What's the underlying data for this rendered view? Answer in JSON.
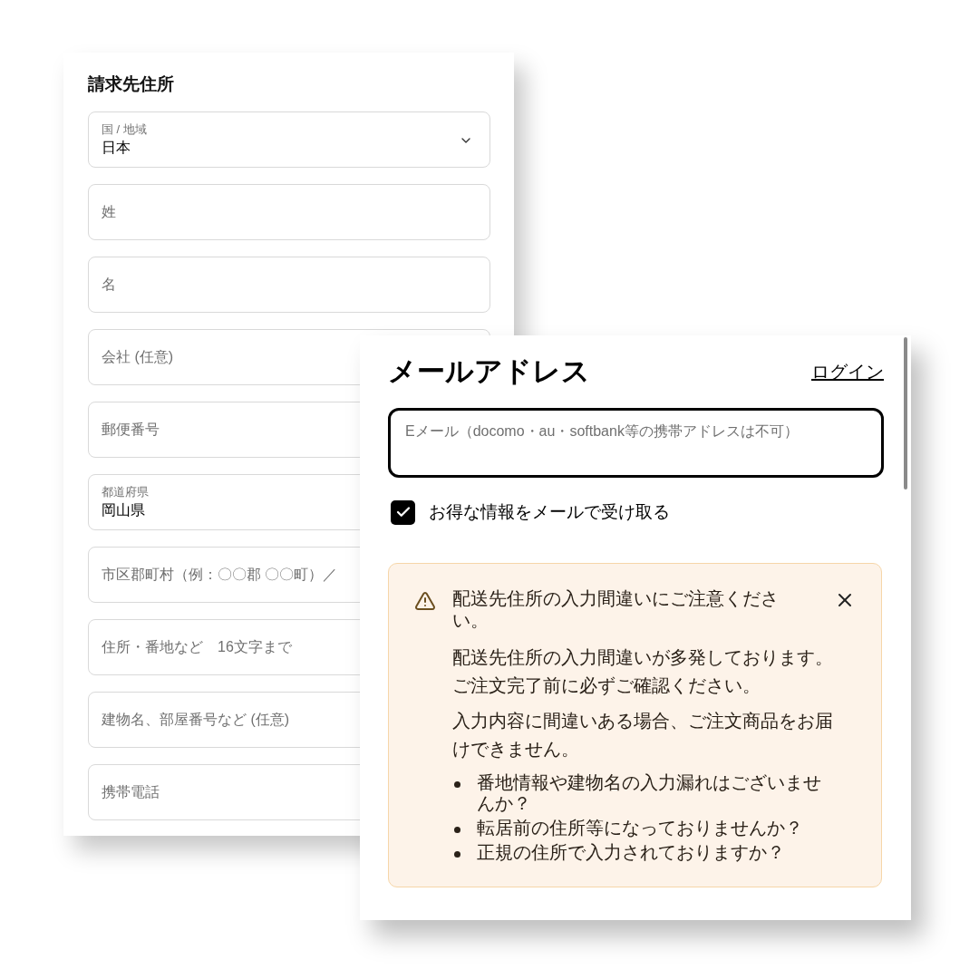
{
  "billing_form": {
    "title": "請求先住所",
    "fields": [
      {
        "kind": "select",
        "label": "国 / 地域",
        "value": "日本"
      },
      {
        "kind": "text",
        "placeholder": "姓"
      },
      {
        "kind": "text",
        "placeholder": "名"
      },
      {
        "kind": "text",
        "placeholder": "会社 (任意)"
      },
      {
        "kind": "text",
        "placeholder": "郵便番号"
      },
      {
        "kind": "labeled",
        "label": "都道府県",
        "value": "岡山県"
      },
      {
        "kind": "text",
        "placeholder": "市区郡町村（例：〇〇郡 〇〇町）／"
      },
      {
        "kind": "text",
        "placeholder": "住所・番地など　16文字まで"
      },
      {
        "kind": "text",
        "placeholder": "建物名、部屋番号など (任意)"
      },
      {
        "kind": "text",
        "placeholder": "携帯電話"
      }
    ]
  },
  "email_panel": {
    "title": "メールアドレス",
    "login_link": "ログイン",
    "email_field": {
      "placeholder": "Eメール（docomo・au・softbank等の携帯アドレスは不可）"
    },
    "newsletter": {
      "label": "お得な情報をメールで受け取る",
      "checked": true
    },
    "alert": {
      "title": "配送先住所の入力間違いにご注意ください。",
      "paragraphs": [
        "配送先住所の入力間違いが多発しております。ご注文完了前に必ずご確認ください。",
        "入力内容に間違いある場合、ご注文商品をお届けできません。"
      ],
      "bullets": [
        "番地情報や建物名の入力漏れはございませんか？",
        "転居前の住所等になっておりませんか？",
        "正規の住所で入力されておりますか？"
      ]
    }
  }
}
